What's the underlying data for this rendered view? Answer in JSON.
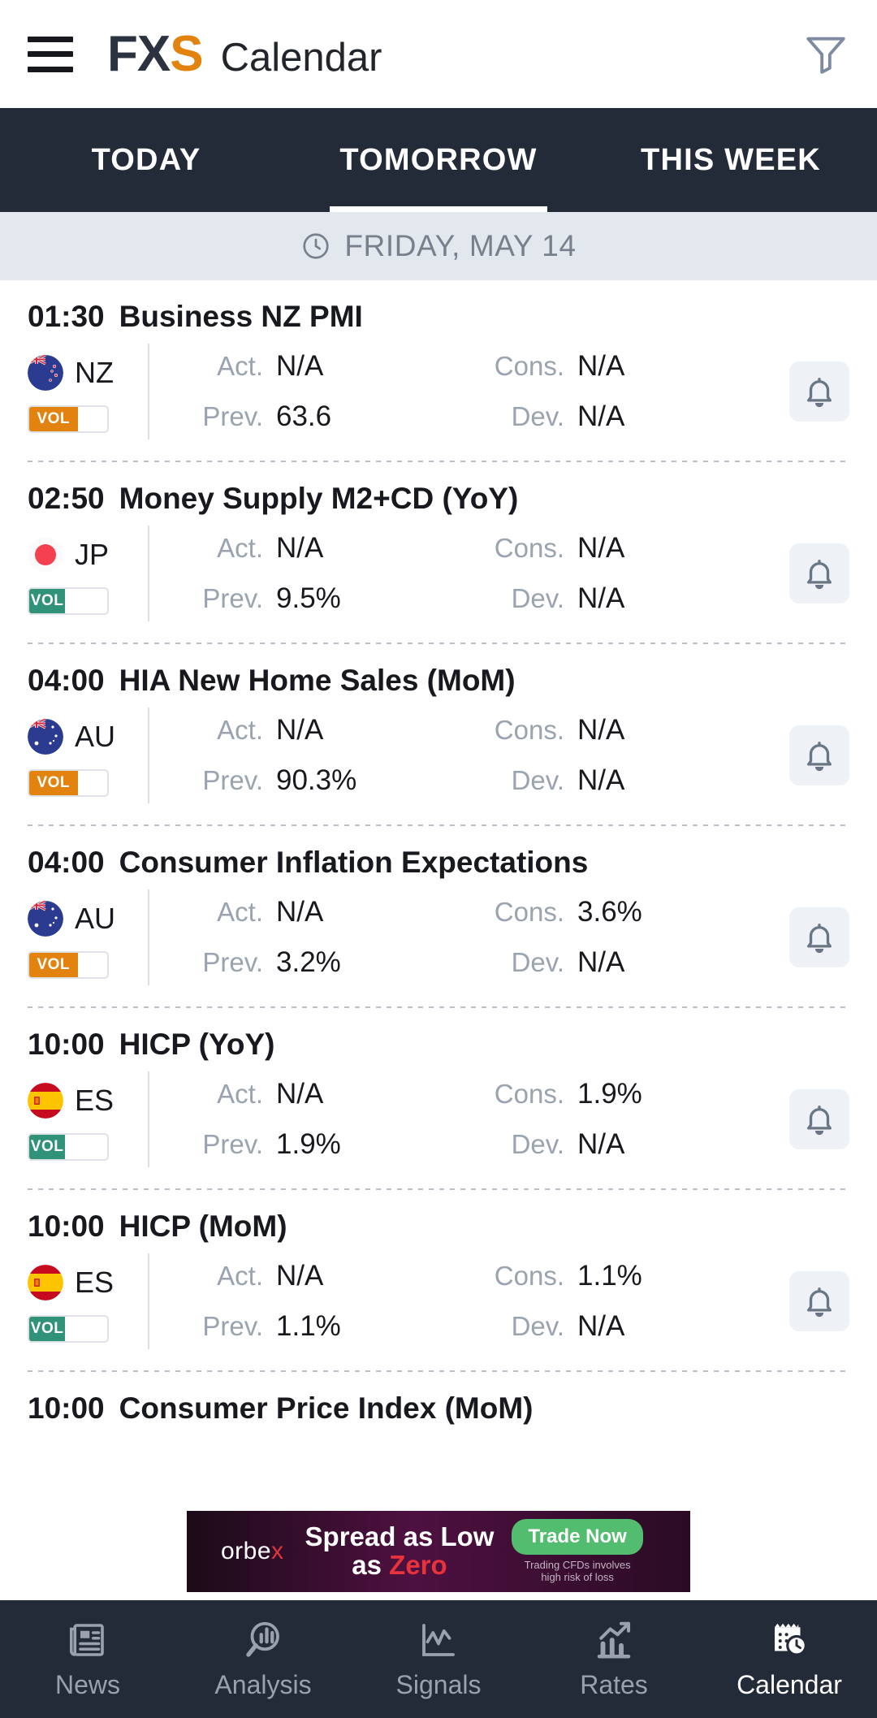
{
  "appbar": {
    "menu_icon": "hamburger-menu-icon",
    "brand_fx": "FX",
    "brand_s": "S",
    "title": "Calendar",
    "filter_icon": "filter-funnel-icon"
  },
  "tabs": [
    {
      "label": "TODAY",
      "active": false
    },
    {
      "label": "TOMORROW",
      "active": true
    },
    {
      "label": "THIS WEEK",
      "active": false
    }
  ],
  "date_header": {
    "icon": "clock-icon",
    "label": "FRIDAY, MAY 14"
  },
  "labels": {
    "act": "Act.",
    "prev": "Prev.",
    "cons": "Cons.",
    "dev": "Dev.",
    "vol": "VOL"
  },
  "colors": {
    "vol_medium": "#e2820f",
    "vol_low": "#2f9279",
    "tab_bar": "#242b38",
    "date_bar": "#e3e8ee",
    "accent_orange": "#e2820f",
    "cta_green": "#52bd6f",
    "ad_red": "#e8323c"
  },
  "events": [
    {
      "time": "01:30",
      "name": "Business NZ PMI",
      "country": "NZ",
      "flag": "nz-flag-icon",
      "vol_level": "medium",
      "vol_fill_pct": 62,
      "act": "N/A",
      "prev": "63.6",
      "cons": "N/A",
      "dev": "N/A",
      "bell": "bell-icon"
    },
    {
      "time": "02:50",
      "name": "Money Supply M2+CD (YoY)",
      "country": "JP",
      "flag": "jp-flag-icon",
      "vol_level": "low",
      "vol_fill_pct": 46,
      "act": "N/A",
      "prev": "9.5%",
      "cons": "N/A",
      "dev": "N/A",
      "bell": "bell-icon"
    },
    {
      "time": "04:00",
      "name": "HIA New Home Sales (MoM)",
      "country": "AU",
      "flag": "au-flag-icon",
      "vol_level": "medium",
      "vol_fill_pct": 62,
      "act": "N/A",
      "prev": "90.3%",
      "cons": "N/A",
      "dev": "N/A",
      "bell": "bell-icon"
    },
    {
      "time": "04:00",
      "name": "Consumer Inflation Expectations",
      "country": "AU",
      "flag": "au-flag-icon",
      "vol_level": "medium",
      "vol_fill_pct": 62,
      "act": "N/A",
      "prev": "3.2%",
      "cons": "3.6%",
      "dev": "N/A",
      "bell": "bell-icon"
    },
    {
      "time": "10:00",
      "name": "HICP (YoY)",
      "country": "ES",
      "flag": "es-flag-icon",
      "vol_level": "low",
      "vol_fill_pct": 46,
      "act": "N/A",
      "prev": "1.9%",
      "cons": "1.9%",
      "dev": "N/A",
      "bell": "bell-icon"
    },
    {
      "time": "10:00",
      "name": "HICP (MoM)",
      "country": "ES",
      "flag": "es-flag-icon",
      "vol_level": "low",
      "vol_fill_pct": 46,
      "act": "N/A",
      "prev": "1.1%",
      "cons": "1.1%",
      "dev": "N/A",
      "bell": "bell-icon"
    }
  ],
  "partial_event": {
    "time": "10:00",
    "name": "Consumer Price Index (MoM)"
  },
  "ad": {
    "logo_main": "orbe",
    "logo_x": "x",
    "line1": "Spread as Low",
    "line2_a": "as ",
    "line2_zero": "Zero",
    "cta": "Trade Now",
    "disclaimer_1": "Trading CFDs involves",
    "disclaimer_2": "high risk of loss"
  },
  "bottom_nav": [
    {
      "label": "News",
      "icon": "newspaper-icon",
      "active": false
    },
    {
      "label": "Analysis",
      "icon": "magnifier-chart-icon",
      "active": false
    },
    {
      "label": "Signals",
      "icon": "line-chart-icon",
      "active": false
    },
    {
      "label": "Rates",
      "icon": "bar-chart-arrow-icon",
      "active": false
    },
    {
      "label": "Calendar",
      "icon": "calendar-clock-icon",
      "active": true
    }
  ]
}
